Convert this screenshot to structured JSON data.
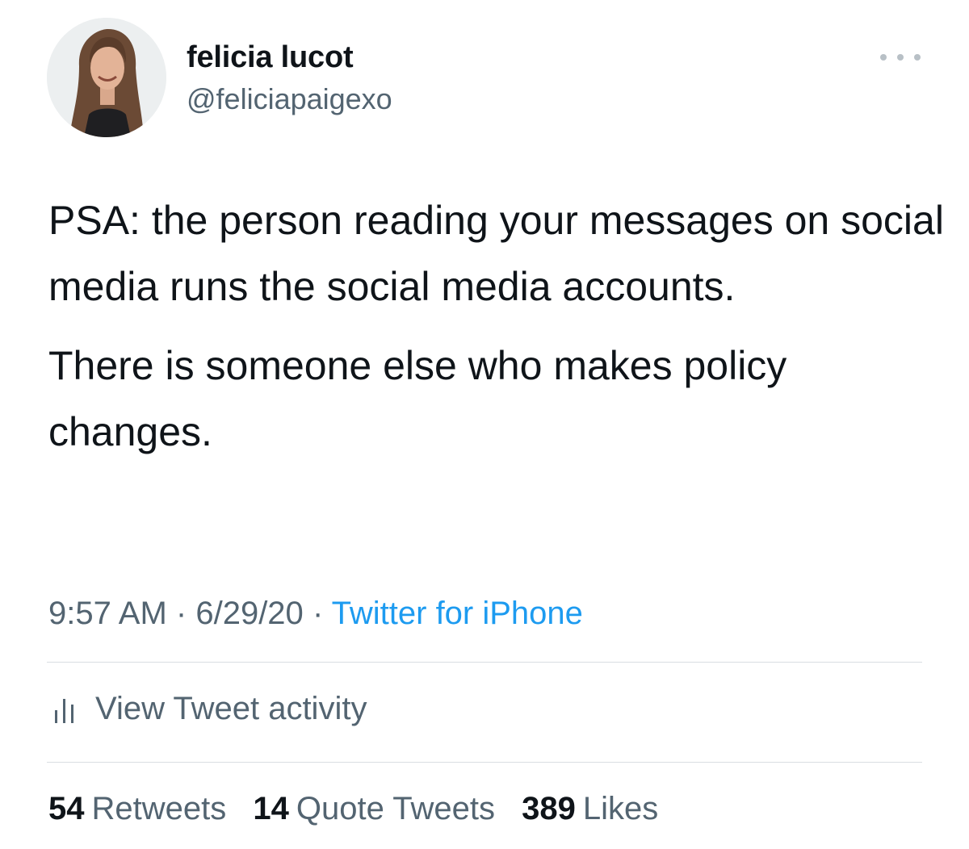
{
  "author": {
    "display_name": "felicia lucot",
    "handle": "@feliciapaigexo"
  },
  "tweet": {
    "paragraphs": [
      "PSA: the person reading your messages on social media runs the social media accounts.",
      "There is someone else who makes policy changes."
    ],
    "time": "9:57 AM",
    "date": "6/29/20",
    "separator": "·",
    "source": "Twitter for iPhone"
  },
  "activity": {
    "label": "View Tweet activity",
    "icon": "bar-chart-icon"
  },
  "stats": {
    "retweets": {
      "count": "54",
      "label": "Retweets"
    },
    "quote_tweets": {
      "count": "14",
      "label": "Quote Tweets"
    },
    "likes": {
      "count": "389",
      "label": "Likes"
    }
  },
  "icons": {
    "more": "more-options-icon"
  },
  "colors": {
    "text": "#0f1419",
    "secondary": "#536471",
    "link": "#1d9bf0",
    "divider": "#d9dee2"
  }
}
